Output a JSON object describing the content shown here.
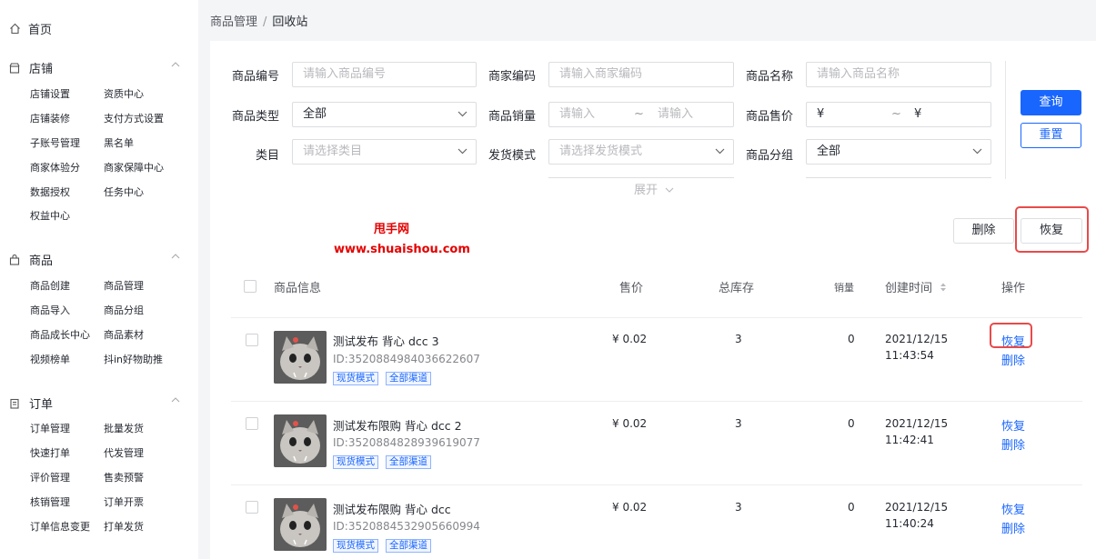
{
  "sidebar": {
    "home": "首页",
    "sections": [
      {
        "title": "店铺",
        "items": [
          "店铺设置",
          "资质中心",
          "店铺装修",
          "支付方式设置",
          "子账号管理",
          "黑名单",
          "商家体验分",
          "商家保障中心",
          "数据授权",
          "任务中心",
          "权益中心"
        ]
      },
      {
        "title": "商品",
        "items": [
          "商品创建",
          "商品管理",
          "商品导入",
          "商品分组",
          "商品成长中心",
          "商品素材",
          "视频榜单",
          "抖in好物助推"
        ]
      },
      {
        "title": "订单",
        "items": [
          "订单管理",
          "批量发货",
          "快速打单",
          "代发管理",
          "评价管理",
          "售卖预警",
          "核销管理",
          "订单开票",
          "订单信息变更",
          "打单发货"
        ]
      }
    ]
  },
  "breadcrumb": {
    "parent": "商品管理",
    "sep": "/",
    "current": "回收站"
  },
  "filters": {
    "goods_no": {
      "label": "商品编号",
      "placeholder": "请输入商品编号"
    },
    "merchant_code": {
      "label": "商家编码",
      "placeholder": "请输入商家编码"
    },
    "goods_name": {
      "label": "商品名称",
      "placeholder": "请输入商品名称"
    },
    "goods_type": {
      "label": "商品类型",
      "value": "全部"
    },
    "sales": {
      "label": "商品销量",
      "from": "请输入",
      "tilde": "~",
      "to": "请输入"
    },
    "price": {
      "label": "商品售价",
      "from": "¥",
      "tilde": "~",
      "to": "¥"
    },
    "category": {
      "label": "类目",
      "placeholder": "请选择类目"
    },
    "ship_mode": {
      "label": "发货模式",
      "placeholder": "请选择发货模式"
    },
    "group": {
      "label": "商品分组",
      "value": "全部"
    },
    "expand": "展开"
  },
  "actions": {
    "query": "查询",
    "reset": "重置",
    "delete": "删除",
    "restore": "恢复"
  },
  "watermark": {
    "line1": "甩手网",
    "line2": "www.shuaishou.com"
  },
  "table": {
    "headers": {
      "info": "商品信息",
      "price": "售价",
      "stock": "总库存",
      "sales": "销量",
      "created": "创建时间",
      "ops": "操作"
    },
    "rows": [
      {
        "name": "测试发布 背心 dcc 3",
        "id": "ID:3520884984036622607",
        "tags": [
          "现货模式",
          "全部渠道"
        ],
        "price": "¥ 0.02",
        "stock": "3",
        "sales": "0",
        "date": "2021/12/15",
        "time": "11:43:54",
        "restore": "恢复",
        "delete": "删除"
      },
      {
        "name": "测试发布限购 背心 dcc 2",
        "id": "ID:3520884828939619077",
        "tags": [
          "现货模式",
          "全部渠道"
        ],
        "price": "¥ 0.02",
        "stock": "3",
        "sales": "0",
        "date": "2021/12/15",
        "time": "11:42:41",
        "restore": "恢复",
        "delete": "删除"
      },
      {
        "name": "测试发布限购 背心 dcc",
        "id": "ID:3520884532905660994",
        "tags": [
          "现货模式",
          "全部渠道"
        ],
        "price": "¥ 0.02",
        "stock": "3",
        "sales": "0",
        "date": "2021/12/15",
        "time": "11:40:24",
        "restore": "恢复",
        "delete": "删除"
      }
    ]
  },
  "colors": {
    "accent": "#1966ff",
    "highlight_box": "#e84a4a",
    "watermark": "#e50000"
  }
}
